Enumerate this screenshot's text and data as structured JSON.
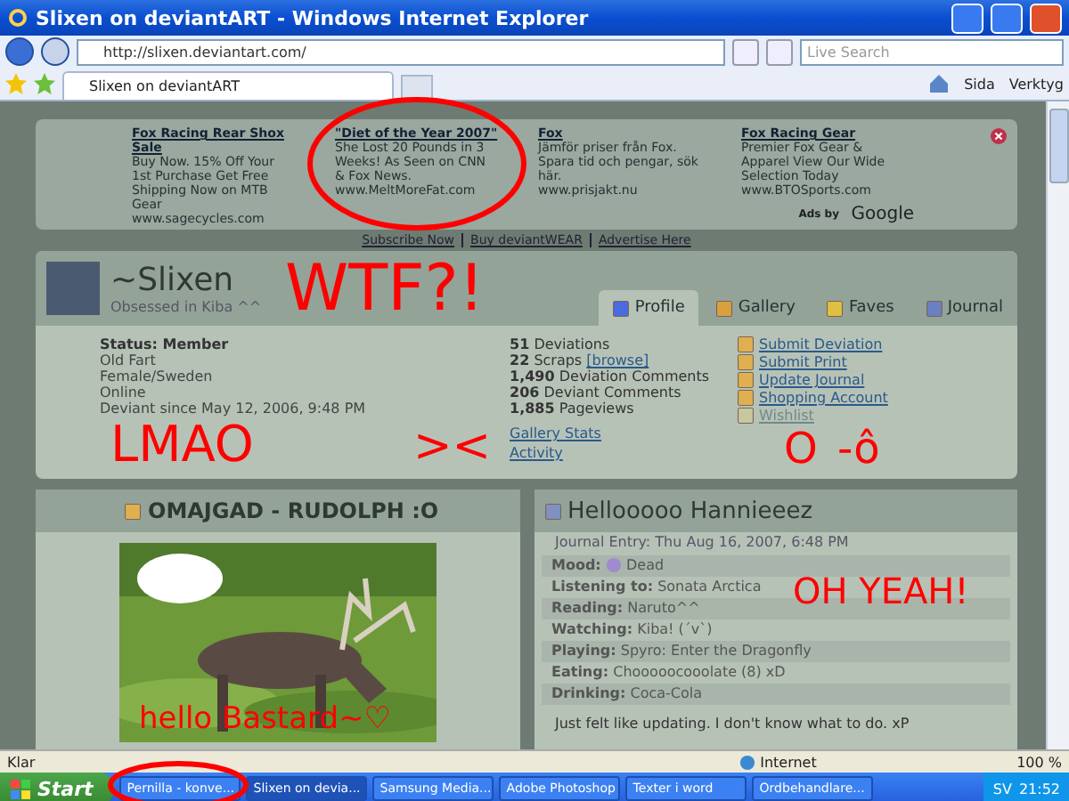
{
  "window": {
    "title": "Slixen on deviantART - Windows Internet Explorer"
  },
  "browser": {
    "address": "http://slixen.deviantart.com/",
    "search_placeholder": "Live Search",
    "tab": "Slixen on deviantART",
    "tools": [
      "Sida",
      "Verktyg"
    ]
  },
  "ads": [
    {
      "title": "Fox Racing Rear Shox Sale",
      "text": "Buy Now. 15% Off Your 1st Purchase Get Free Shipping Now on MTB Gear",
      "url": "www.sagecycles.com"
    },
    {
      "title": "\"Diet of the Year 2007\"",
      "text": "She Lost 20 Pounds in 3 Weeks! As Seen on CNN & Fox News.",
      "url": "www.MeltMoreFat.com"
    },
    {
      "title": "Fox",
      "text": "Jämför priser från Fox. Spara tid och pengar, sök här.",
      "url": "www.prisjakt.nu"
    },
    {
      "title": "Fox Racing Gear",
      "text": "Premier Fox Gear & Apparel View Our Wide Selection Today",
      "url": "www.BTOSports.com"
    }
  ],
  "ads_by": "Ads by",
  "ads_brand": "Google",
  "site_links": [
    "Subscribe Now",
    "Buy deviantWEAR",
    "Advertise Here"
  ],
  "profile": {
    "name": "~Slixen",
    "tagline": "Obsessed in Kiba ^^",
    "tabs": [
      {
        "label": "Profile",
        "selected": true
      },
      {
        "label": "Gallery",
        "selected": false
      },
      {
        "label": "Faves",
        "selected": false
      },
      {
        "label": "Journal",
        "selected": false
      }
    ],
    "status": "Status: Member",
    "details": [
      "Old Fart",
      "Female/Sweden",
      "Online",
      "Deviant since May 12, 2006, 9:48 PM"
    ],
    "stats": [
      {
        "count": "51",
        "label": "Deviations"
      },
      {
        "count": "22",
        "label": "Scraps",
        "link": "[browse]"
      },
      {
        "count": "1,490",
        "label": "Deviation Comments"
      },
      {
        "count": "206",
        "label": "Deviant Comments"
      },
      {
        "count": "1,885",
        "label": "Pageviews"
      }
    ],
    "stat_links": [
      "Gallery Stats",
      "Activity"
    ],
    "actions": [
      {
        "label": "Submit Deviation",
        "disabled": false
      },
      {
        "label": "Submit Print",
        "disabled": false
      },
      {
        "label": "Update Journal",
        "disabled": false
      },
      {
        "label": "Shopping Account",
        "disabled": false
      },
      {
        "label": "Wishlist",
        "disabled": true
      }
    ]
  },
  "deviation": {
    "title": "OMAJGAD - RUDOLPH :O"
  },
  "journal": {
    "title": "Hellooooo Hannieeez",
    "date": "Journal Entry: Thu Aug 16, 2007, 6:48 PM",
    "fields": [
      {
        "label": "Mood:",
        "value": "Dead"
      },
      {
        "label": "Listening to:",
        "value": "Sonata Arctica"
      },
      {
        "label": "Reading:",
        "value": "Naruto^^"
      },
      {
        "label": "Watching:",
        "value": "Kiba! (´v`)"
      },
      {
        "label": "Playing:",
        "value": "Spyro: Enter the Dragonfly"
      },
      {
        "label": "Eating:",
        "value": "Chooooocooolate (8) xD"
      },
      {
        "label": "Drinking:",
        "value": "Coca-Cola"
      }
    ],
    "body": "Just felt like updating. I don't know what to do. xP"
  },
  "status_bar": {
    "text": "Klar",
    "zone": "Internet",
    "zoom": "100 %"
  },
  "taskbar": {
    "start": "Start",
    "items": [
      {
        "label": "Pernilla - konve...",
        "selected": false
      },
      {
        "label": "Slixen on devia...",
        "selected": true
      },
      {
        "label": "Samsung Media...",
        "selected": false
      },
      {
        "label": "Adobe Photoshop",
        "selected": false
      },
      {
        "label": "Texter i word",
        "selected": false
      },
      {
        "label": "Ordbehandlare...",
        "selected": false
      }
    ],
    "language": "SV",
    "clock": "21:52"
  },
  "scribbles": [
    "WTF?!",
    "LMAO",
    "><",
    "O",
    "-ô",
    "OH YEAH!",
    "hello Bastard~♡"
  ]
}
